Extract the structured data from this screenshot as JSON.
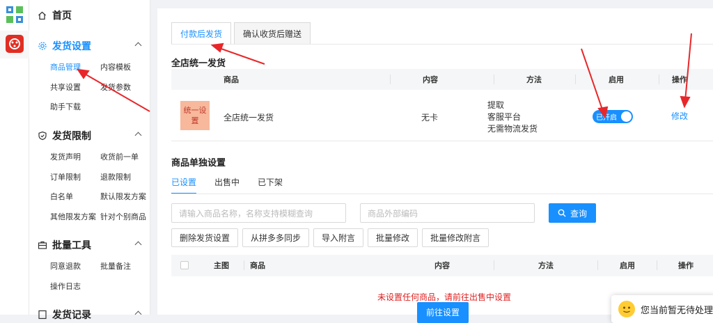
{
  "sidebar": {
    "home": "首页",
    "sections": [
      {
        "title": "发货设置",
        "items": [
          "商品管理",
          "内容模板",
          "共享设置",
          "发货参数",
          "助手下载"
        ]
      },
      {
        "title": "发货限制",
        "items": [
          "发货声明",
          "收货前一单",
          "订单限制",
          "退款限制",
          "白名单",
          "默认限发方案",
          "其他限发方案",
          "针对个别商品"
        ]
      },
      {
        "title": "批量工具",
        "items": [
          "同意退款",
          "批量备注",
          "操作日志"
        ]
      },
      {
        "title": "发货记录"
      }
    ]
  },
  "tabs": [
    "付款后发货",
    "确认收货后赠送"
  ],
  "unified": {
    "title": "全店统一发货",
    "headers": [
      "商品",
      "内容",
      "方法",
      "启用",
      "操作"
    ],
    "row": {
      "badge": "统一设置",
      "product": "全店统一发货",
      "content": "无卡",
      "methods": [
        "提取",
        "客服平台",
        "无需物流发货"
      ],
      "switch_label": "已开启",
      "action": "修改"
    }
  },
  "single": {
    "title": "商品单独设置",
    "subtabs": [
      "已设置",
      "出售中",
      "已下架"
    ],
    "search_placeholder": "请输入商品名称，名称支持模糊查询",
    "code_placeholder": "商品外部编码",
    "search_button": "查询",
    "buttons": [
      "删除发货设置",
      "从拼多多同步",
      "导入附言",
      "批量修改",
      "批量修改附言"
    ],
    "headers": [
      "主图",
      "商品",
      "内容",
      "方法",
      "启用",
      "操作"
    ],
    "empty_message": "未设置任何商品，请前往出售中设置",
    "goto_button": "前往设置"
  },
  "toast": {
    "text": "您当前暂无待处理"
  },
  "colors": {
    "accent": "#1890ff",
    "alert": "#e02020",
    "arrow": "#e8272a"
  }
}
